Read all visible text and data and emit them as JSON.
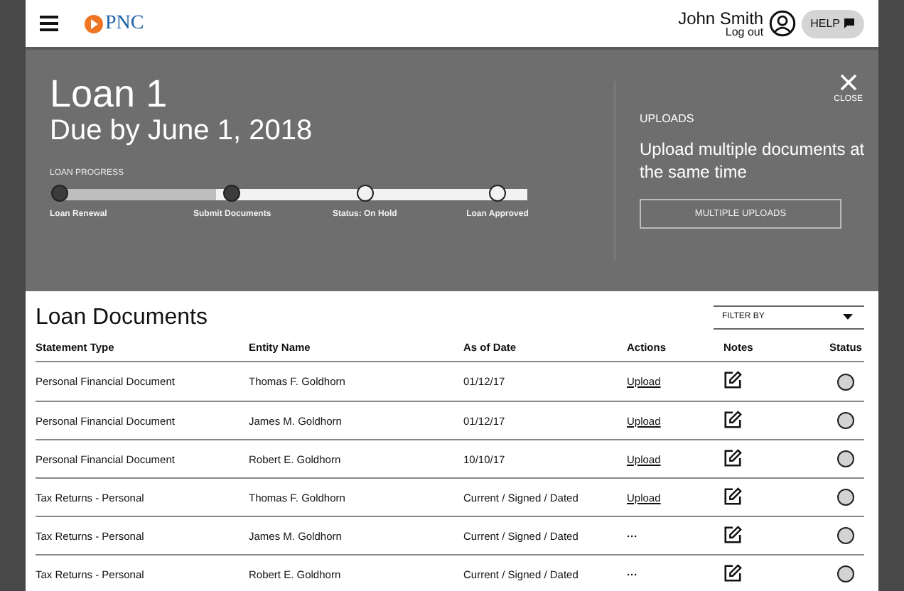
{
  "header": {
    "brand": "PNC",
    "user_name": "John Smith",
    "logout": "Log out",
    "help": "HELP"
  },
  "loan": {
    "title": "Loan 1",
    "due": "Due by June 1, 2018",
    "progress_label": "LOAN PROGRESS",
    "level": 0.333,
    "steps": [
      {
        "label": "Loan Renewal",
        "done": true
      },
      {
        "label": "Submit Documents",
        "done": true
      },
      {
        "label": "Status: On Hold",
        "done": false
      },
      {
        "label": "Loan Approved",
        "done": false
      }
    ]
  },
  "uploads": {
    "close": "CLOSE",
    "heading": "UPLOADS",
    "text": "Upload multiple documents at the same time",
    "button": "MULTIPLE UPLOADS"
  },
  "documents": {
    "title": "Loan Documents",
    "filter": "FILTER BY",
    "columns": [
      "Statement Type",
      "Entity Name",
      "As of Date",
      "Actions",
      "Notes",
      "Status"
    ],
    "rows": [
      {
        "statement_type": "Personal Financial Document",
        "entity_name": "Thomas F. Goldhorn",
        "as_of_date": "01/12/17",
        "action": "Upload",
        "kind": "link"
      },
      {
        "statement_type": "Personal Financial Document",
        "entity_name": "James M. Goldhorn",
        "as_of_date": "01/12/17",
        "action": "Upload",
        "kind": "link"
      },
      {
        "statement_type": "Personal Financial Document",
        "entity_name": "Robert E. Goldhorn",
        "as_of_date": "10/10/17",
        "action": "Upload",
        "kind": "link"
      },
      {
        "statement_type": "Tax Returns - Personal",
        "entity_name": "Thomas F. Goldhorn",
        "as_of_date": "Current / Signed / Dated",
        "action": "Upload",
        "kind": "link"
      },
      {
        "statement_type": "Tax Returns - Personal",
        "entity_name": "James M. Goldhorn",
        "as_of_date": "Current / Signed / Dated",
        "action": "···",
        "kind": "more"
      },
      {
        "statement_type": "Tax Returns - Personal",
        "entity_name": "Robert E. Goldhorn",
        "as_of_date": "Current / Signed / Dated",
        "action": "···",
        "kind": "more"
      }
    ]
  }
}
